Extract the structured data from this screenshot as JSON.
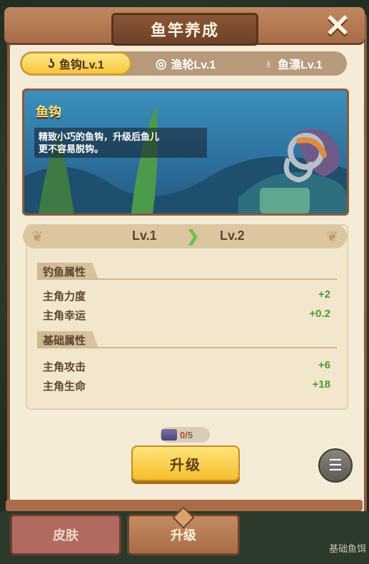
{
  "title": "鱼竿养成",
  "tabs": [
    {
      "label": "鱼钩Lv.1",
      "icon": "hook-icon",
      "active": true
    },
    {
      "label": "渔轮Lv.1",
      "icon": "reel-icon",
      "active": false
    },
    {
      "label": "鱼漂Lv.1",
      "icon": "float-icon",
      "active": false
    }
  ],
  "banner": {
    "name": "鱼钩",
    "desc_line1": "精致小巧的鱼钩，升级后鱼儿",
    "desc_line2": "更不容易脱钩。"
  },
  "level": {
    "from": "Lv.1",
    "to": "Lv.2"
  },
  "sections": [
    {
      "title": "钓鱼属性",
      "rows": [
        {
          "label": "主角力度",
          "value": "+2"
        },
        {
          "label": "主角幸运",
          "value": "+0.2"
        }
      ]
    },
    {
      "title": "基础属性",
      "rows": [
        {
          "label": "主角攻击",
          "value": "+6"
        },
        {
          "label": "主角生命",
          "value": "+18"
        }
      ]
    }
  ],
  "cost": {
    "current": "0",
    "total": "/5"
  },
  "upgrade_label": "升级",
  "bottom_tabs": {
    "skin": "皮肤",
    "upgrade": "升级"
  },
  "corner_text": "基础鱼饵"
}
